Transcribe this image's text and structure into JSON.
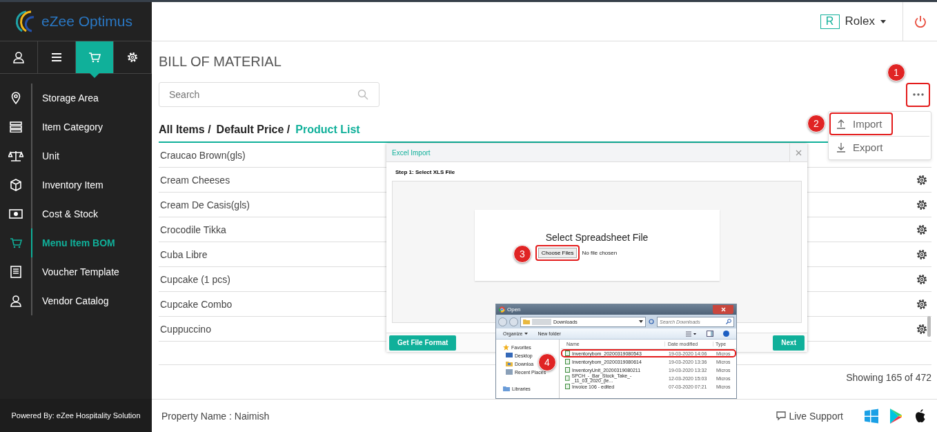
{
  "sidebar": {
    "brand": "eZee Optimus",
    "tabs": [
      {
        "selected": false
      },
      {
        "selected": false
      },
      {
        "selected": true
      },
      {
        "selected": false
      }
    ],
    "items": [
      {
        "label": "Storage Area",
        "selected": false
      },
      {
        "label": "Item Category",
        "selected": false
      },
      {
        "label": "Unit",
        "selected": false
      },
      {
        "label": "Inventory Item",
        "selected": false
      },
      {
        "label": "Cost & Stock",
        "selected": false
      },
      {
        "label": "Menu Item BOM",
        "selected": true
      },
      {
        "label": "Voucher Template",
        "selected": false
      },
      {
        "label": "Vendor Catalog",
        "selected": false
      }
    ],
    "footer": "Powered By: eZee Hospitality Solution"
  },
  "header": {
    "user_initial": "R",
    "user_name": "Rolex"
  },
  "page": {
    "title": "BILL OF MATERIAL",
    "search": {
      "placeholder": "Search"
    },
    "more_button": {
      "highlighted": true
    },
    "breadcrumbs": [
      {
        "label": "All Items /",
        "selected": false
      },
      {
        "label": "Default Price /",
        "selected": false
      },
      {
        "label": "Product List",
        "selected": true
      }
    ],
    "rows": [
      {
        "name": "Craucao Brown(gls)"
      },
      {
        "name": "Cream Cheeses"
      },
      {
        "name": "Cream De Casis(gls)"
      },
      {
        "name": "Crocodile Tikka"
      },
      {
        "name": "Cuba Libre"
      },
      {
        "name": "Cupcake (1 pcs)"
      },
      {
        "name": "Cupcake Combo"
      },
      {
        "name": "Cuppuccino"
      }
    ],
    "count": "Showing 165 of 472"
  },
  "more_menu": [
    {
      "label": "Import",
      "kind": "import",
      "highlighted": true
    },
    {
      "label": "Export",
      "kind": "export",
      "highlighted": false
    }
  ],
  "excel_import": {
    "title": "Excel Import",
    "step": "Step 1: Select XLS File",
    "heading": "Select Spreadsheet File",
    "choose_button": "Choose Files",
    "choose_highlighted": true,
    "file_status": "No file chosen",
    "format_button": "Get File Format",
    "next_button": "Next"
  },
  "open_dialog": {
    "title": "Open",
    "path": "Downloads",
    "search_placeholder": "Search Downloads",
    "organize": "Organize",
    "new_folder": "New folder",
    "nav": [
      {
        "label": "Favorites",
        "kind": "group"
      },
      {
        "label": "Desktop",
        "kind": "item"
      },
      {
        "label": "Downloa",
        "kind": "item"
      },
      {
        "label": "Recent Places",
        "kind": "item"
      },
      {
        "label": "Libraries",
        "kind": "group"
      }
    ],
    "columns": [
      "Name",
      "Date modified",
      "Type"
    ],
    "files": [
      {
        "name": "Inventorybom_20200319080543",
        "date": "19-03-2020 14:06",
        "type": "Micros",
        "highlighted": true
      },
      {
        "name": "Inventorybom_20200319080614",
        "date": "19-03-2020 13:36",
        "type": "Micros",
        "highlighted": false
      },
      {
        "name": "InventoryUnit_20200319080211",
        "date": "19-03-2020 13:32",
        "type": "Micros",
        "highlighted": false
      },
      {
        "name": "SPCH_-_Bar_Stock_Take_-_11_03_2020_(le...",
        "date": "12-03-2020 15:03",
        "type": "Micros",
        "highlighted": false
      },
      {
        "name": "Invoice 106 - edited",
        "date": "07-03-2020 07:21",
        "type": "Micros",
        "highlighted": false
      }
    ]
  },
  "steps": [
    "1",
    "2",
    "3",
    "4"
  ],
  "footer": {
    "property": "Property Name : Naimish",
    "live_support": "Live Support"
  }
}
